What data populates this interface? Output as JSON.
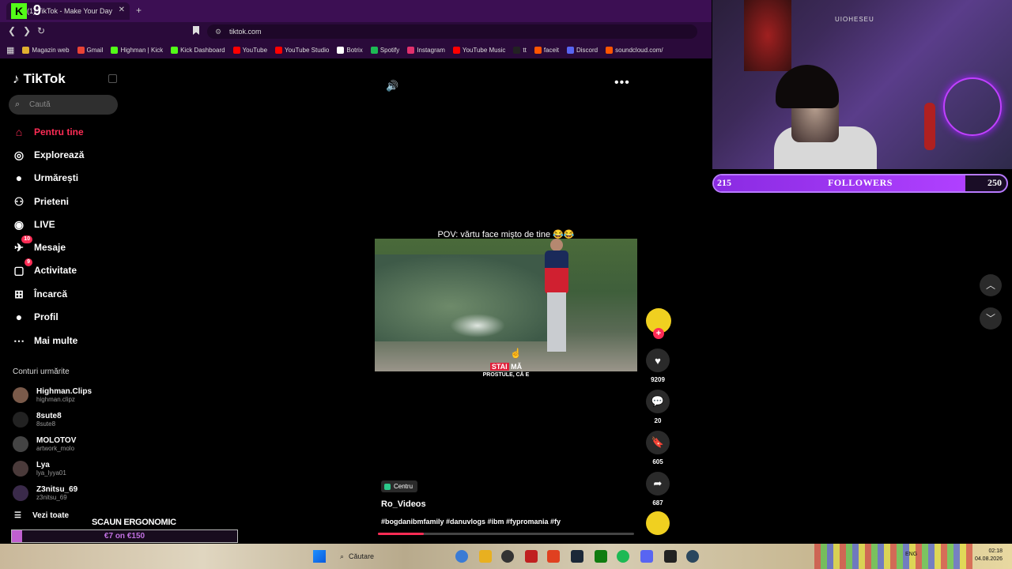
{
  "browser": {
    "tab_title": "(1) TikTok - Make Your Day",
    "stream_badge": "9",
    "kick_letter": "K",
    "url": "tiktok.com",
    "bookmarks": [
      {
        "label": "Magazin web",
        "color": "#e0b030"
      },
      {
        "label": "Gmail",
        "color": "#ea4335"
      },
      {
        "label": "Highman | Kick",
        "color": "#53fc18"
      },
      {
        "label": "Kick Dashboard",
        "color": "#53fc18"
      },
      {
        "label": "YouTube",
        "color": "#ff0000"
      },
      {
        "label": "YouTube Studio",
        "color": "#ff0000"
      },
      {
        "label": "Botrix",
        "color": "#ffffff"
      },
      {
        "label": "Spotify",
        "color": "#1db954"
      },
      {
        "label": "Instagram",
        "color": "#e1306c"
      },
      {
        "label": "YouTube Music",
        "color": "#ff0000"
      },
      {
        "label": "tt",
        "color": "#222222"
      },
      {
        "label": "faceit",
        "color": "#ff5500"
      },
      {
        "label": "Discord",
        "color": "#5865f2"
      },
      {
        "label": "soundcloud.com/",
        "color": "#ff5500"
      }
    ]
  },
  "tiktok": {
    "logo_text": "TikTok",
    "search_placeholder": "Caută",
    "nav": [
      {
        "label": "Pentru tine",
        "icon": "home-icon",
        "badge": ""
      },
      {
        "label": "Explorează",
        "icon": "compass-icon",
        "badge": ""
      },
      {
        "label": "Urmărești",
        "icon": "following-avatar-icon",
        "badge": ""
      },
      {
        "label": "Prieteni",
        "icon": "friends-icon",
        "badge": ""
      },
      {
        "label": "LIVE",
        "icon": "live-icon",
        "badge": ""
      },
      {
        "label": "Mesaje",
        "icon": "messages-icon",
        "badge": "10"
      },
      {
        "label": "Activitate",
        "icon": "activity-icon",
        "badge": "9"
      },
      {
        "label": "Încarcă",
        "icon": "upload-icon",
        "badge": ""
      },
      {
        "label": "Profil",
        "icon": "profile-avatar-icon",
        "badge": ""
      },
      {
        "label": "Mai multe",
        "icon": "more-icon",
        "badge": ""
      }
    ],
    "following_title": "Conturi urmărite",
    "following": [
      {
        "name": "Highman.Clips",
        "handle": "highman.clipz"
      },
      {
        "name": "8sute8",
        "handle": "8sute8"
      },
      {
        "name": "MOLOTOV",
        "handle": "artwork_molo"
      },
      {
        "name": "Lya",
        "handle": "lya_lyya01"
      },
      {
        "name": "Z3nitsu_69",
        "handle": "z3nitsu_69"
      }
    ],
    "see_all": "Vezi toate",
    "video": {
      "caption": "POV: vărtu face mişto de tine 😂😂",
      "subtitle_highlight": "STAI",
      "subtitle_rest": "MĂ",
      "subtitle_line2": "PROSTULE, CĂ E",
      "likes": "9209",
      "comments": "20",
      "saves": "605",
      "shares": "687",
      "location_tag": "Centru",
      "author": "Ro_Videos",
      "hashtags": "#bogdanibmfamily #danuvlogs #ibm #fypromania #fy",
      "progress": 0.18
    }
  },
  "overlay": {
    "followers_current": "215",
    "followers_label": "FOLLOWERS",
    "followers_goal": "250",
    "followers_progress": 0.86,
    "chair_label": "SCAUN ERGONOMIC",
    "chair_amount": "€7 on €150",
    "chair_progress": 0.047,
    "cam_sign": "UIOHESEU"
  },
  "taskbar": {
    "search_label": "Căutare",
    "lang": "ENG",
    "time": "02:18",
    "date": "04.08.2026"
  },
  "colors": {
    "tiktok_accent": "#fe2c55",
    "browser_purple": "#3c0f53",
    "follow_bar": "#8a2be2"
  }
}
